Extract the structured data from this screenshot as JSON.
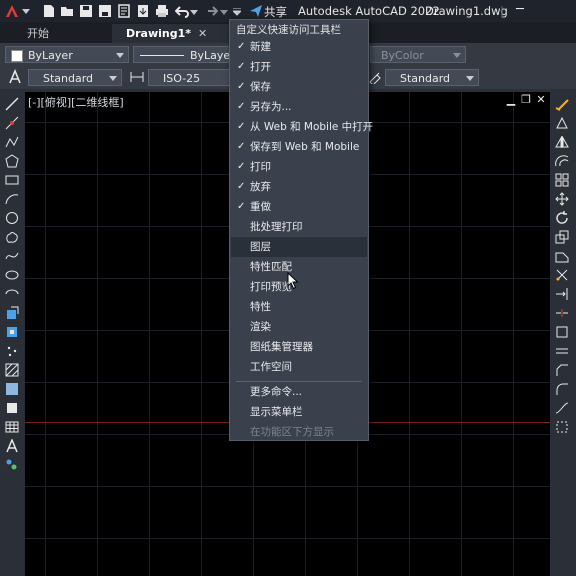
{
  "titlebar": {
    "share_label": "共享",
    "app_title": "Autodesk AutoCAD 2022",
    "file_name": "Drawing1.dwg",
    "icons": [
      "autocad-logo-icon",
      "new-icon",
      "open-icon",
      "save-icon",
      "save-as-icon",
      "web-mobile-icon",
      "plot-icon",
      "undo-icon",
      "redo-icon",
      "customize-dropdown-icon",
      "share-icon"
    ]
  },
  "tabs": [
    {
      "label": "开始"
    },
    {
      "label": "Drawing1*"
    }
  ],
  "properties": {
    "layer": "ByLayer",
    "linetype": "ByLayer",
    "color": "ByColor",
    "text_style": "Standard",
    "dim_style": "ISO-25",
    "table_style": "Standard"
  },
  "viewport": {
    "label": "[-][俯视][二维线框]",
    "minimize": "▁",
    "restore": "❐",
    "close": "✕"
  },
  "menu": {
    "title": "自定义快速访问工具栏",
    "items": [
      {
        "label": "新建",
        "check": "✓"
      },
      {
        "label": "打开",
        "check": "✓"
      },
      {
        "label": "保存",
        "check": "✓"
      },
      {
        "label": "另存为...",
        "check": "✓"
      },
      {
        "label": "从 Web 和 Mobile 中打开",
        "check": "✓"
      },
      {
        "label": "保存到 Web 和 Mobile",
        "check": "✓"
      },
      {
        "label": "打印",
        "check": "✓"
      },
      {
        "label": "放弃",
        "check": "✓"
      },
      {
        "label": "重做",
        "check": "✓"
      },
      {
        "label": "批处理打印",
        "check": ""
      },
      {
        "label": "图层",
        "check": ""
      },
      {
        "label": "特性匹配",
        "check": ""
      },
      {
        "label": "打印预览",
        "check": ""
      },
      {
        "label": "特性",
        "check": ""
      },
      {
        "label": "渲染",
        "check": ""
      },
      {
        "label": "图纸集管理器",
        "check": ""
      },
      {
        "label": "工作空间",
        "check": ""
      },
      {
        "label": "更多命令...",
        "check": ""
      },
      {
        "label": "显示菜单栏",
        "check": ""
      },
      {
        "label": "在功能区下方显示",
        "check": ""
      }
    ]
  },
  "colors": {
    "accent": "#e03a3a",
    "menu_bg": "#3b414c",
    "canvas_bg": "#000000"
  }
}
